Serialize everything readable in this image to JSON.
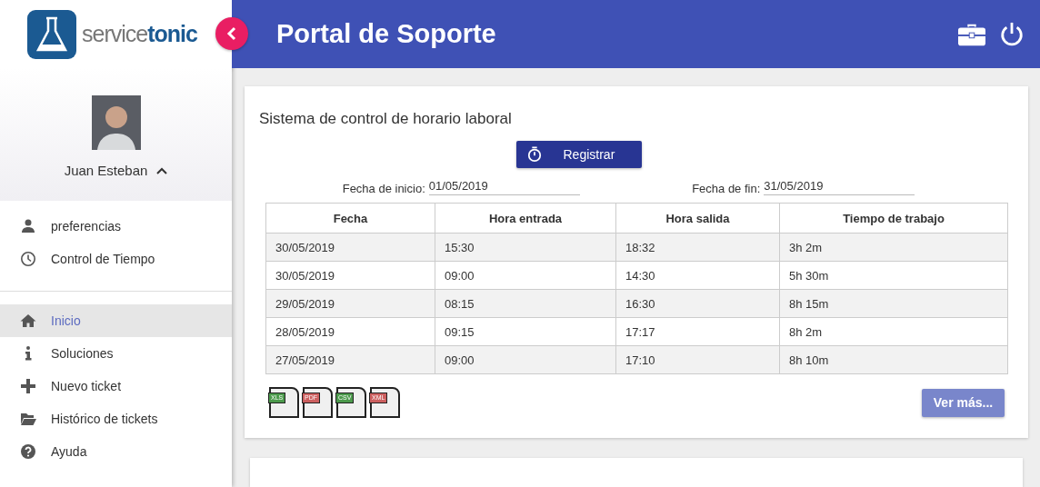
{
  "logo": {
    "light": "service",
    "bold": "tonic"
  },
  "header": {
    "title": "Portal de Soporte"
  },
  "user": {
    "name": "Juan Esteban",
    "expanded": true
  },
  "user_menu": [
    {
      "label": "preferencias",
      "kind": "person"
    },
    {
      "label": "Control de Tiempo",
      "kind": "clock"
    }
  ],
  "nav": [
    {
      "label": "Inicio",
      "kind": "home",
      "selected": true
    },
    {
      "label": "Soluciones",
      "kind": "info",
      "selected": false
    },
    {
      "label": "Nuevo ticket",
      "kind": "plus",
      "selected": false
    },
    {
      "label": "Histórico de tickets",
      "kind": "folder",
      "selected": false
    },
    {
      "label": "Ayuda",
      "kind": "help",
      "selected": false
    }
  ],
  "card": {
    "title": "Sistema de control de horario laboral",
    "register_button": "Registrar",
    "start": {
      "label": "Fecha de inicio:",
      "value": "01/05/2019"
    },
    "end": {
      "label": "Fecha de fin:",
      "value": "31/05/2019"
    },
    "table": {
      "columns": [
        "Fecha",
        "Hora entrada",
        "Hora salida",
        "Tiempo de trabajo"
      ],
      "rows": [
        [
          "30/05/2019",
          "15:30",
          "18:32",
          "3h 2m"
        ],
        [
          "30/05/2019",
          "09:00",
          "14:30",
          "5h 30m"
        ],
        [
          "29/05/2019",
          "08:15",
          "16:30",
          "8h 15m"
        ],
        [
          "28/05/2019",
          "09:15",
          "17:17",
          "8h 2m"
        ],
        [
          "27/05/2019",
          "09:00",
          "17:10",
          "8h 10m"
        ]
      ]
    },
    "exports": [
      {
        "label": "XLS",
        "color": "#4c9a4c"
      },
      {
        "label": "PDF",
        "color": "#cc5f5f"
      },
      {
        "label": "CSV",
        "color": "#4c9a4c"
      },
      {
        "label": "XML",
        "color": "#cc5f5f"
      }
    ],
    "more_button": "Ver más..."
  }
}
